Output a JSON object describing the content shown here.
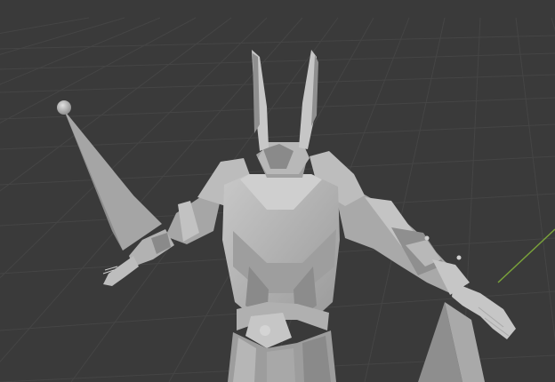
{
  "viewport": {
    "mode": "3d-viewport-solid-shading",
    "scene_object": "armored-character-t-pose",
    "colors": {
      "background": "#3a3a3a",
      "grid_line": "#454545",
      "grid_axis_y": "#7aa23a",
      "model_light": "#b9b9b9",
      "model_mid": "#9c9c9c",
      "model_dark": "#737373",
      "bone_light": "#a8a8a8",
      "bone_dark": "#7d7d7d"
    }
  }
}
